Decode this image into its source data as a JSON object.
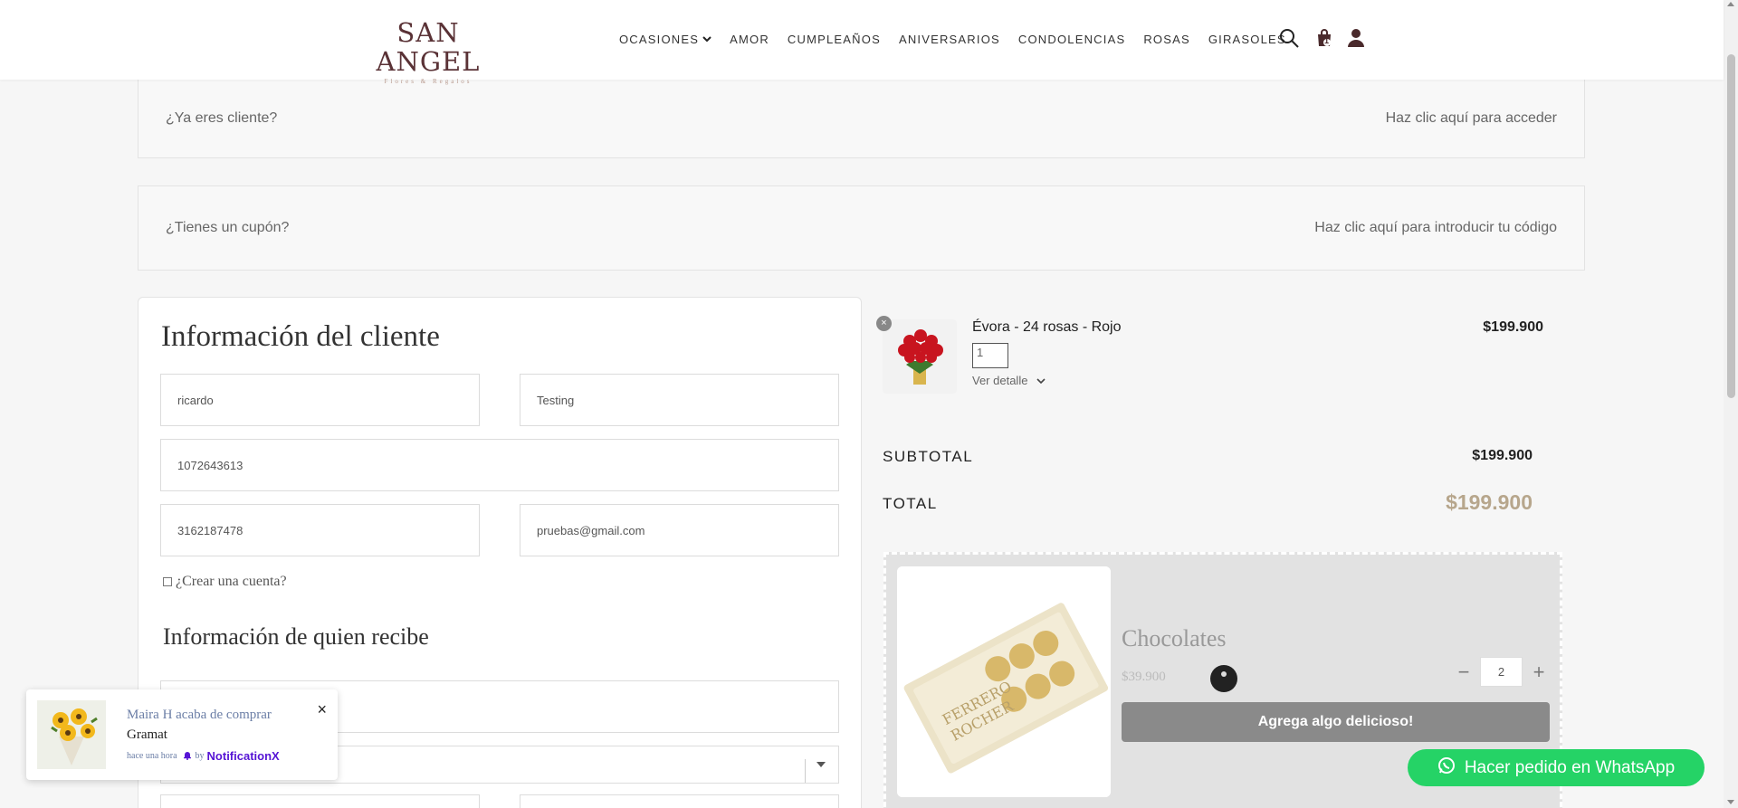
{
  "brand": {
    "name": "SAN ANGEL",
    "tagline": "Flores & Regalos"
  },
  "nav": {
    "items": [
      "OCASIONES",
      "AMOR",
      "CUMPLEAÑOS",
      "ANIVERSARIOS",
      "CONDOLENCIAS",
      "ROSAS",
      "GIRASOLES"
    ],
    "icons": [
      "search-icon",
      "cart-icon",
      "user-icon"
    ],
    "cart_count": "1"
  },
  "notices": {
    "login_question": "¿Ya eres cliente?",
    "login_link": "Haz clic aquí para acceder",
    "coupon_question": "¿Tienes un cupón?",
    "coupon_link": "Haz clic aquí para introducir tu código"
  },
  "customer": {
    "title": "Información del cliente",
    "first_name": "ricardo",
    "last_name": "Testing",
    "document": "1072643613",
    "phone": "3162187478",
    "email": "pruebas@gmail.com",
    "create_account": "¿Crear una cuenta?"
  },
  "recipient": {
    "title": "Información de quien recibe"
  },
  "order": {
    "product_name": "Évora - 24 rosas - Rojo",
    "product_qty": "1",
    "product_detail": "Ver detalle",
    "product_price": "$199.900",
    "subtotal_label": "SUBTOTAL",
    "subtotal_value": "$199.900",
    "total_label": "TOTAL",
    "total_value": "$199.900"
  },
  "upsell": {
    "name": "Chocolates",
    "price": "$39.900",
    "qty": "2",
    "button": "Agrega algo delicioso!"
  },
  "whatsapp": {
    "label": "Hacer pedido en WhatsApp"
  },
  "notification": {
    "title": "Maira H acaba de comprar",
    "product": "Gramat",
    "time": "hace una hora",
    "by": "by",
    "brand": "NotificationX"
  },
  "colors": {
    "total_accent": "#b7a68c",
    "whatsapp": "#25d366",
    "logo": "#5a3236"
  }
}
